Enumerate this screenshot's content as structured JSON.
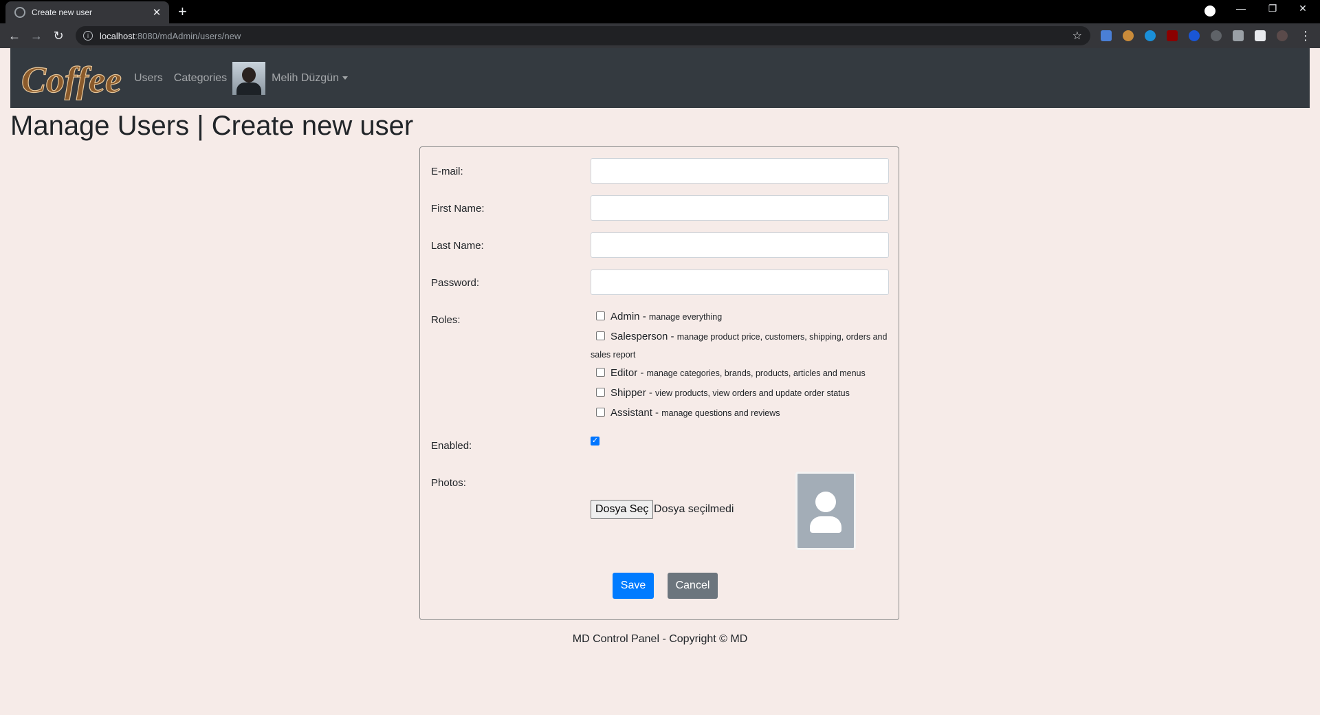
{
  "browser": {
    "tab_title": "Create new user",
    "url_host": "localhost",
    "url_path": ":8080/mdAdmin/users/new"
  },
  "navbar": {
    "logo_text": "Coffee",
    "links": [
      "Users",
      "Categories"
    ],
    "user_name": "Melih Düzgün"
  },
  "page": {
    "title": "Manage Users | Create new user"
  },
  "form": {
    "email_label": "E-mail:",
    "email_value": "",
    "first_name_label": "First Name:",
    "first_name_value": "",
    "last_name_label": "Last Name:",
    "last_name_value": "",
    "password_label": "Password:",
    "password_value": "",
    "roles_label": "Roles:",
    "roles": [
      {
        "name": "Admin",
        "desc": "manage everything",
        "checked": false
      },
      {
        "name": "Salesperson",
        "desc": "manage product price, customers, shipping, orders and sales report",
        "checked": false
      },
      {
        "name": "Editor",
        "desc": "manage categories, brands, products, articles and menus",
        "checked": false
      },
      {
        "name": "Shipper",
        "desc": "view products, view orders and update order status",
        "checked": false
      },
      {
        "name": "Assistant",
        "desc": "manage questions and reviews",
        "checked": false
      }
    ],
    "role_separator": " - ",
    "enabled_label": "Enabled:",
    "enabled_checked": true,
    "photos_label": "Photos:",
    "file_button": "Dosya Seç",
    "file_status": "Dosya seçilmedi",
    "save_label": "Save",
    "cancel_label": "Cancel"
  },
  "footer": {
    "text": "MD Control Panel - Copyright © MD"
  },
  "colors": {
    "page_bg": "#f6ebe8",
    "navbar_bg": "#343a40",
    "primary": "#007bff",
    "secondary": "#6c757d"
  }
}
